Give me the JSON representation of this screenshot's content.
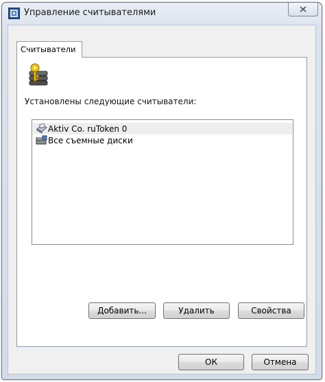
{
  "window": {
    "title": "Управление считывателями"
  },
  "tabs": [
    {
      "label": "Считыватели"
    }
  ],
  "panel": {
    "installed_label": "Установлены следующие считыватели:",
    "readers": [
      {
        "name": "Aktiv Co. ruToken 0",
        "icon": "smartcard-reader-icon",
        "selected": true
      },
      {
        "name": "Все съемные диски",
        "icon": "removable-drive-icon",
        "selected": false
      }
    ],
    "buttons": {
      "add": "Добавить...",
      "remove": "Удалить",
      "properties": "Свойства"
    }
  },
  "footer": {
    "ok": "ОК",
    "cancel": "Отмена"
  },
  "colors": {
    "title_gradient": "#dbe4ee",
    "client_bg": "#f0f0f0",
    "selected_row": "#eeeeee"
  }
}
